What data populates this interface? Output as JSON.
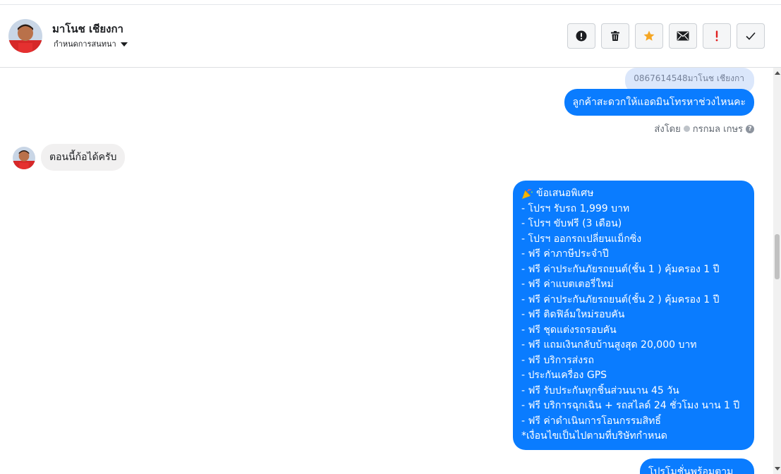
{
  "header": {
    "contact_name": "มาโนช เชียงกา",
    "assign_label": "กำหนดการสนทนา",
    "actions": [
      {
        "name": "report-button",
        "icon": "exclamation-circle-icon"
      },
      {
        "name": "delete-button",
        "icon": "trash-icon"
      },
      {
        "name": "star-button",
        "icon": "star-icon"
      },
      {
        "name": "mark-unread-button",
        "icon": "envelope-icon"
      },
      {
        "name": "spam-button",
        "icon": "red-exclamation-icon"
      },
      {
        "name": "done-button",
        "icon": "checkmark-icon"
      }
    ]
  },
  "colors": {
    "outgoing_bubble": "#0a7cff",
    "incoming_bubble": "#f1f0f0",
    "quoted_bubble": "#dbe7fb",
    "star": "#f5a623",
    "spam": "#e02020"
  },
  "thread": {
    "quoted_text": "0867614548มาโนช เชียงกา",
    "outgoing_1": "ลูกค้าสะดวกให้แอดมินโทรหาช่วงไหนคะ",
    "sent_by_label": "ส่งโดย",
    "sent_by_name": "กรกมล เกษร",
    "incoming_1": "ตอนนี้ก้อได้ครับ",
    "offer_icon": "party-popper-icon",
    "offer_title": "ข้อเสนอพิเศษ",
    "offer_lines": [
      " - โปรฯ รับรถ 1,999 บาท",
      " - โปรฯ ขับฟรี (3 เดือน)",
      " - โปรฯ ออกรถเปลี่ยนแม็กซิ่ง",
      " - ฟรี ค่าภาษีประจำปี",
      " - ฟรี ค่าประกันภัยรถยนต์(ชั้น 1 ) คุ้มครอง 1 ปี",
      " - ฟรี ค่าแบตเตอรี่ใหม่",
      " - ฟรี ค่าประกันภัยรถยนต์(ชั้น 2 ) คุ้มครอง 1 ปี",
      " - ฟรี ติดฟิล์มใหม่รอบคัน",
      " - ฟรี ชุดแต่งรถรอบคัน",
      " - ฟรี แถมเงินกลับบ้านสูงสุด 20,000 บาท",
      " - ฟรี บริการส่งรถ",
      " - ประกันเครื่อง GPS",
      " - ฟรี รับประกันทุกชิ้นส่วนนาน 45 วัน",
      " - ฟรี บริการฉุกเฉิน + รถสไลด์ 24 ชั่วโมง นาน 1 ปี",
      " - ฟรี ค่าดำเนินการโอนกรรมสิทธิ์"
    ],
    "offer_footer": "*เงื่อนไขเป็นไปตามที่บริษัทกำหนด",
    "outgoing_partial": "โปรโมชั่นพร้อมตาม"
  }
}
